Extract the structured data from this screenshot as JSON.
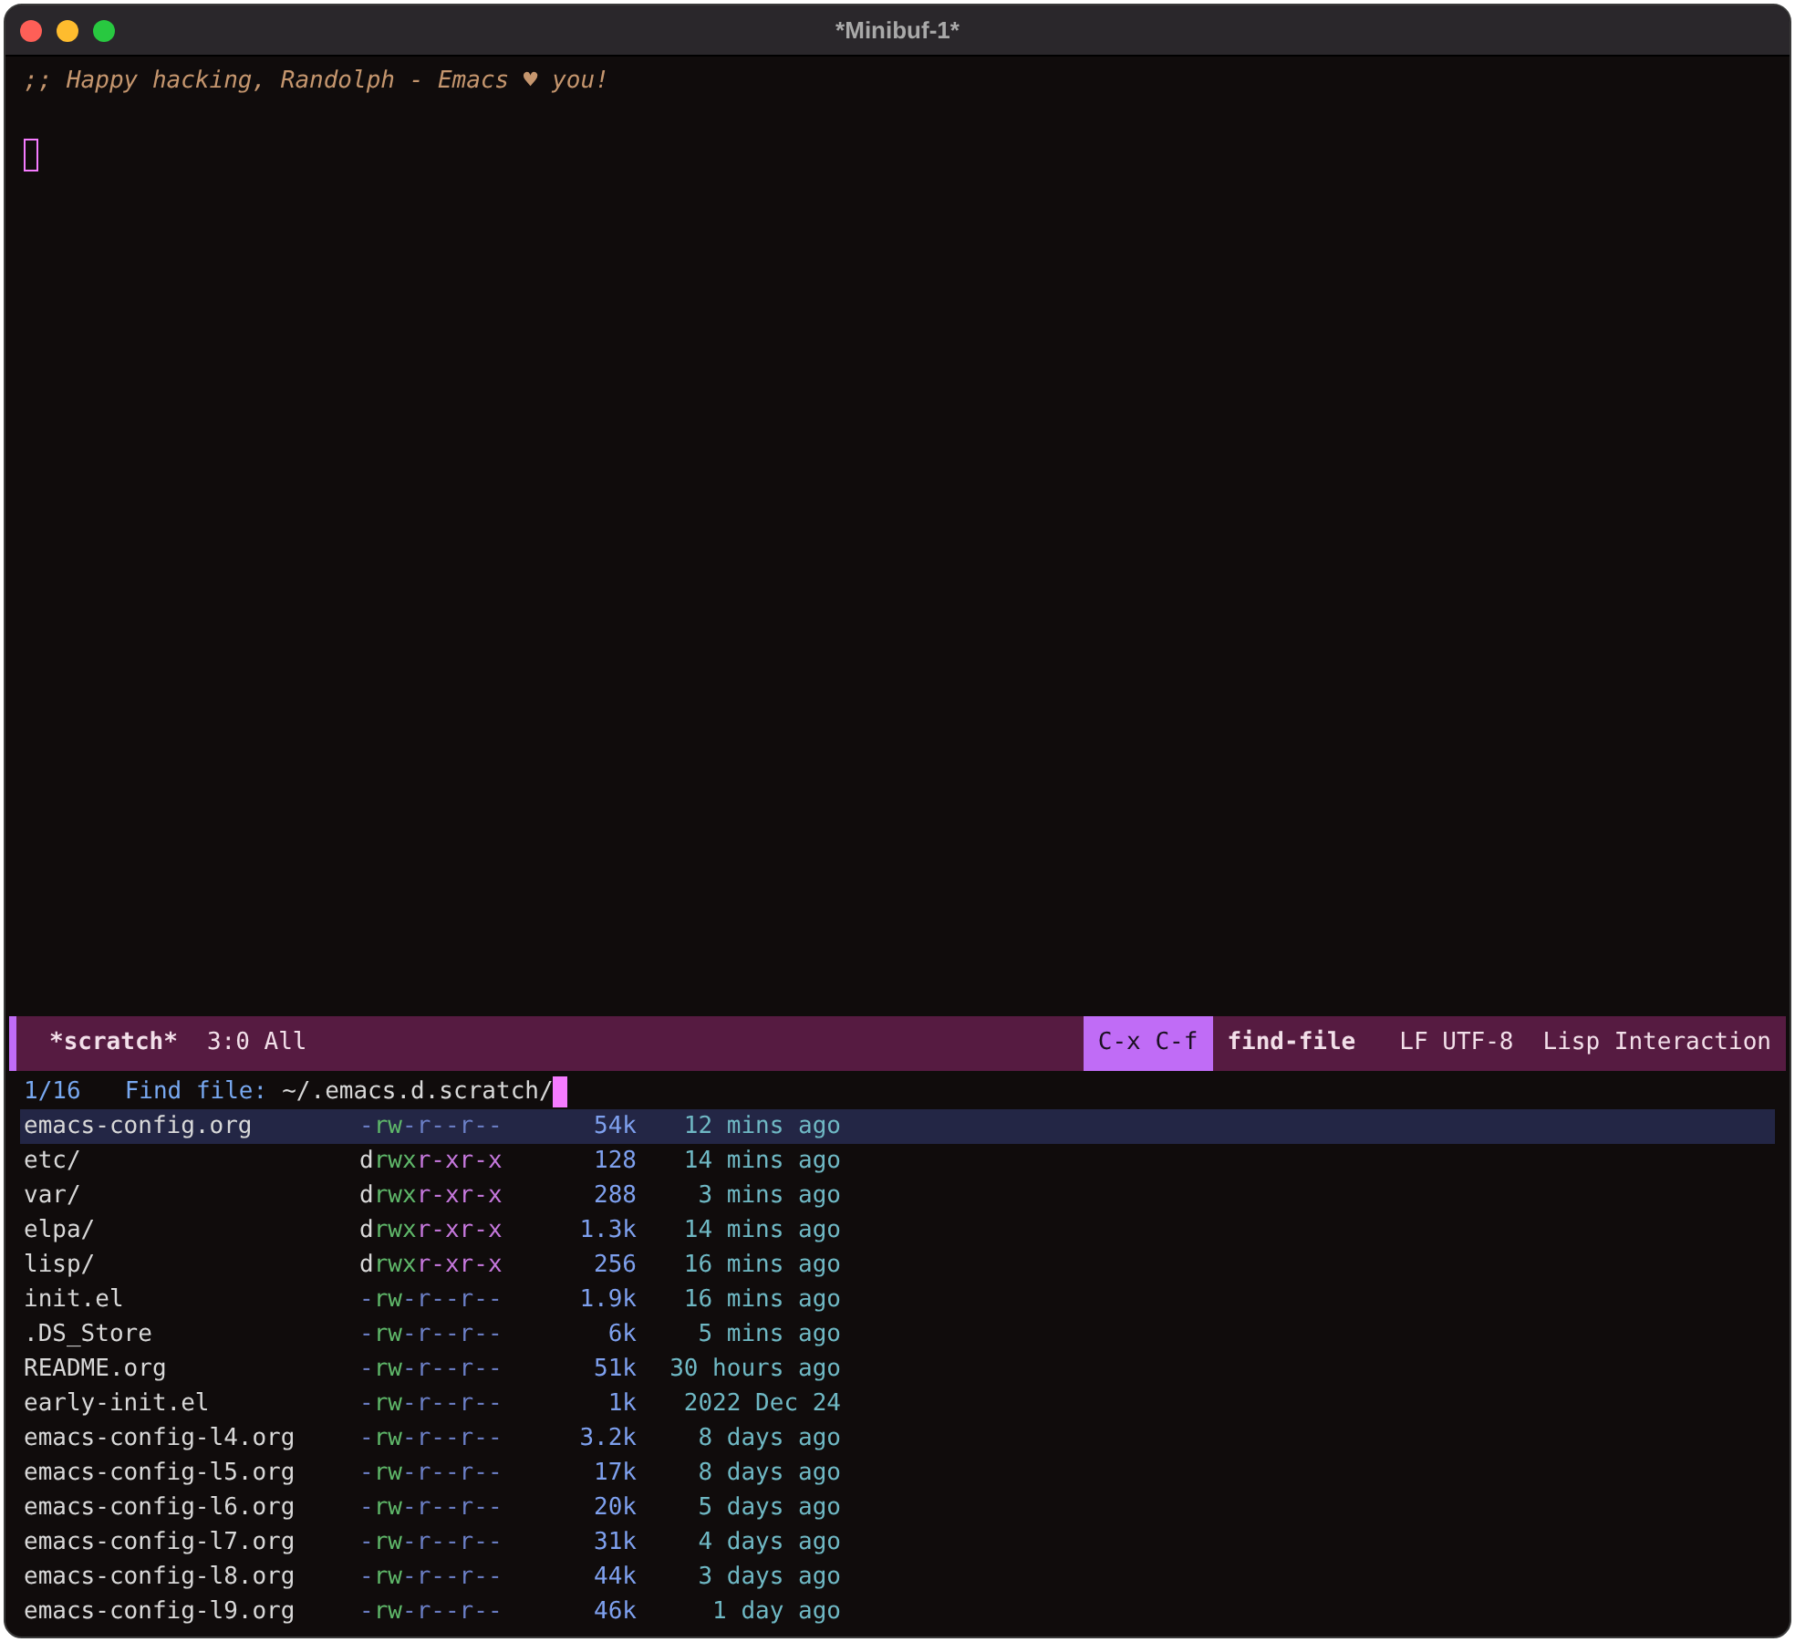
{
  "window": {
    "title": "*Minibuf-1*"
  },
  "editor": {
    "comment": ";; Happy hacking, Randolph - Emacs ♥ you!"
  },
  "mode_line": {
    "buffer": "*scratch*",
    "position": "3:0 All",
    "keys": "C-x C-f",
    "command": "find-file",
    "encoding": "LF UTF-8",
    "mode": "Lisp Interaction"
  },
  "minibuffer": {
    "count": "1/16",
    "prompt": "Find file:",
    "value": "~/.emacs.d.scratch/"
  },
  "files": [
    {
      "name": "emacs-config.org",
      "perms": "-rw-r--r--",
      "size": "54k",
      "time": "12 mins ago",
      "selected": true
    },
    {
      "name": "etc/",
      "perms": "drwxr-xr-x",
      "size": "128",
      "time": "14 mins ago",
      "selected": false
    },
    {
      "name": "var/",
      "perms": "drwxr-xr-x",
      "size": "288",
      "time": "3 mins ago",
      "selected": false
    },
    {
      "name": "elpa/",
      "perms": "drwxr-xr-x",
      "size": "1.3k",
      "time": "14 mins ago",
      "selected": false
    },
    {
      "name": "lisp/",
      "perms": "drwxr-xr-x",
      "size": "256",
      "time": "16 mins ago",
      "selected": false
    },
    {
      "name": "init.el",
      "perms": "-rw-r--r--",
      "size": "1.9k",
      "time": "16 mins ago",
      "selected": false
    },
    {
      "name": ".DS_Store",
      "perms": "-rw-r--r--",
      "size": "6k",
      "time": "5 mins ago",
      "selected": false
    },
    {
      "name": "README.org",
      "perms": "-rw-r--r--",
      "size": "51k",
      "time": "30 hours ago",
      "selected": false
    },
    {
      "name": "early-init.el",
      "perms": "-rw-r--r--",
      "size": "1k",
      "time": "2022 Dec 24",
      "selected": false
    },
    {
      "name": "emacs-config-l4.org",
      "perms": "-rw-r--r--",
      "size": "3.2k",
      "time": "8 days ago",
      "selected": false
    },
    {
      "name": "emacs-config-l5.org",
      "perms": "-rw-r--r--",
      "size": "17k",
      "time": "8 days ago",
      "selected": false
    },
    {
      "name": "emacs-config-l6.org",
      "perms": "-rw-r--r--",
      "size": "20k",
      "time": "5 days ago",
      "selected": false
    },
    {
      "name": "emacs-config-l7.org",
      "perms": "-rw-r--r--",
      "size": "31k",
      "time": "4 days ago",
      "selected": false
    },
    {
      "name": "emacs-config-l8.org",
      "perms": "-rw-r--r--",
      "size": "44k",
      "time": "3 days ago",
      "selected": false
    },
    {
      "name": "emacs-config-l9.org",
      "perms": "-rw-r--r--",
      "size": "46k",
      "time": "1 day ago",
      "selected": false
    }
  ]
}
